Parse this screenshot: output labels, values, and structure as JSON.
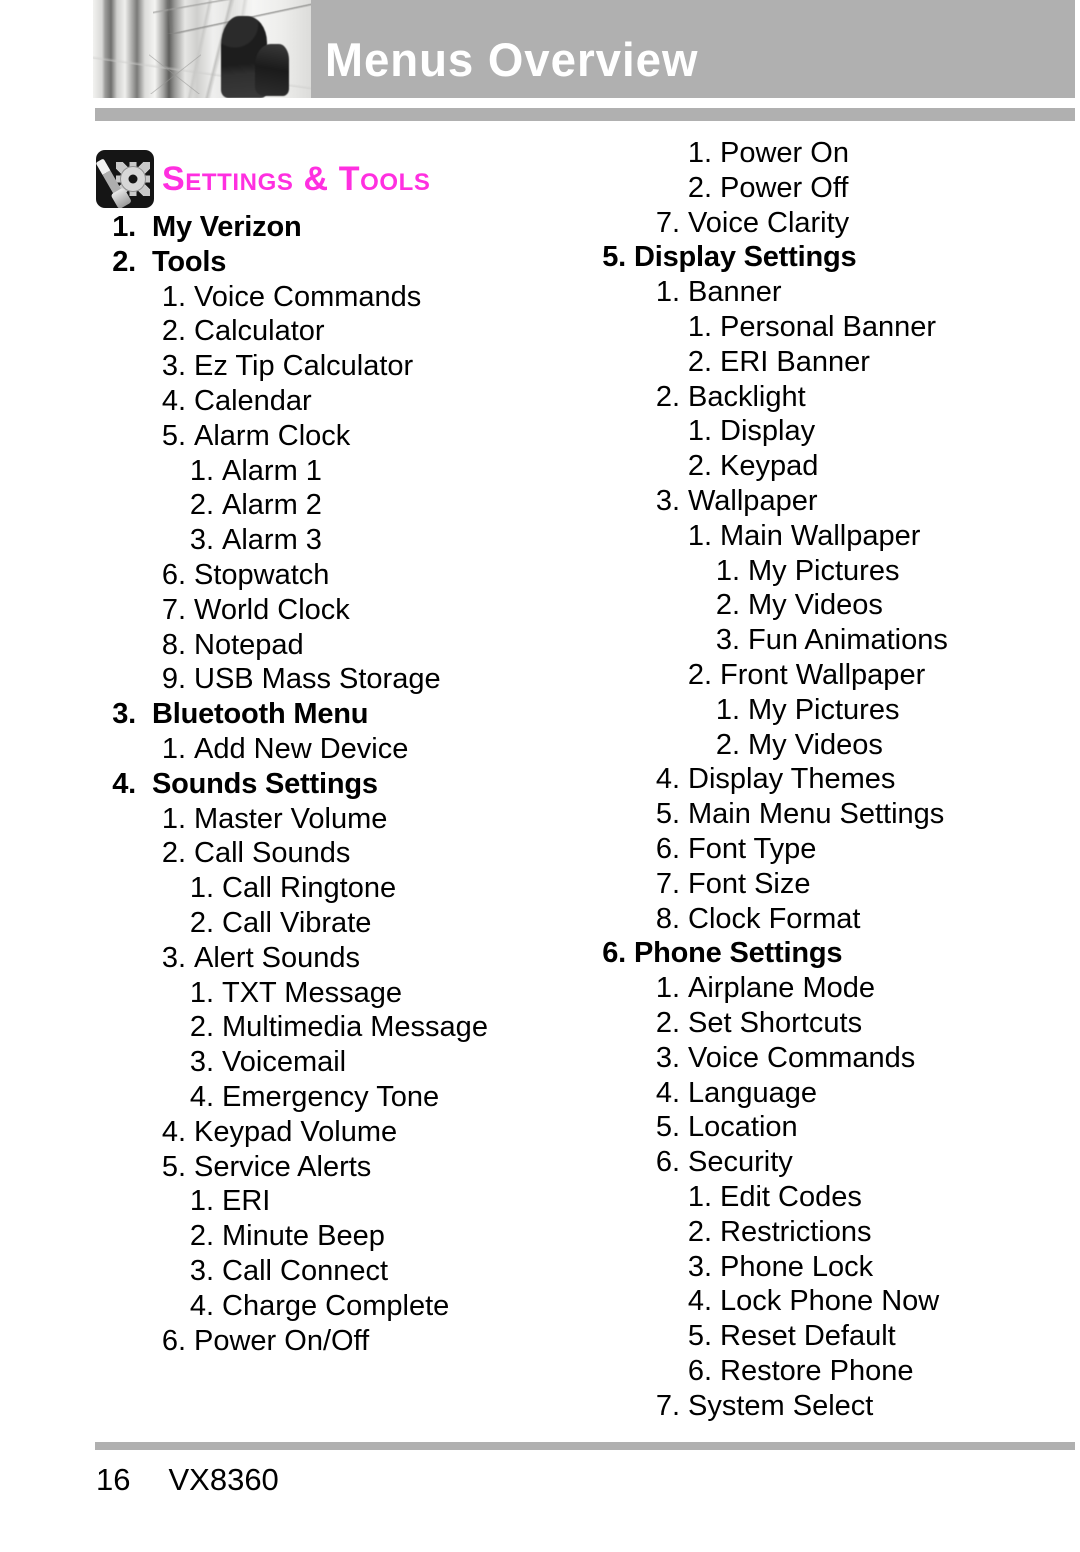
{
  "header": {
    "title": "Menus Overview",
    "photo_alt": "grayscale-architecture-photo"
  },
  "section": {
    "icon_name": "settings-tools-icon",
    "title": "Settings & Tools"
  },
  "left_column": [
    {
      "level": 1,
      "num": "1.",
      "label": "My Verizon",
      "bold": true
    },
    {
      "level": 1,
      "num": "2.",
      "label": "Tools",
      "bold": true
    },
    {
      "level": 2,
      "num": "1.",
      "label": "Voice Commands",
      "bold": false
    },
    {
      "level": 2,
      "num": "2.",
      "label": "Calculator",
      "bold": false
    },
    {
      "level": 2,
      "num": "3.",
      "label": "Ez Tip Calculator",
      "bold": false
    },
    {
      "level": 2,
      "num": "4.",
      "label": "Calendar",
      "bold": false
    },
    {
      "level": 2,
      "num": "5.",
      "label": "Alarm Clock",
      "bold": false
    },
    {
      "level": 3,
      "num": "1.",
      "label": "Alarm 1",
      "bold": false
    },
    {
      "level": 3,
      "num": "2.",
      "label": "Alarm 2",
      "bold": false
    },
    {
      "level": 3,
      "num": "3.",
      "label": "Alarm 3",
      "bold": false
    },
    {
      "level": 2,
      "num": "6.",
      "label": "Stopwatch",
      "bold": false
    },
    {
      "level": 2,
      "num": "7.",
      "label": "World Clock",
      "bold": false
    },
    {
      "level": 2,
      "num": "8.",
      "label": "Notepad",
      "bold": false
    },
    {
      "level": 2,
      "num": "9.",
      "label": "USB Mass Storage",
      "bold": false
    },
    {
      "level": 1,
      "num": "3.",
      "label": "Bluetooth Menu",
      "bold": true
    },
    {
      "level": 2,
      "num": "1.",
      "label": "Add New Device",
      "bold": false
    },
    {
      "level": 1,
      "num": "4.",
      "label": "Sounds Settings",
      "bold": true
    },
    {
      "level": 2,
      "num": "1.",
      "label": "Master Volume",
      "bold": false
    },
    {
      "level": 2,
      "num": "2.",
      "label": "Call Sounds",
      "bold": false
    },
    {
      "level": 3,
      "num": "1.",
      "label": "Call Ringtone",
      "bold": false
    },
    {
      "level": 3,
      "num": "2.",
      "label": "Call Vibrate",
      "bold": false
    },
    {
      "level": 2,
      "num": "3.",
      "label": "Alert Sounds",
      "bold": false
    },
    {
      "level": 3,
      "num": "1.",
      "label": "TXT Message",
      "bold": false
    },
    {
      "level": 3,
      "num": "2.",
      "label": "Multimedia Message",
      "bold": false
    },
    {
      "level": 3,
      "num": "3.",
      "label": "Voicemail",
      "bold": false
    },
    {
      "level": 3,
      "num": "4.",
      "label": "Emergency Tone",
      "bold": false
    },
    {
      "level": 2,
      "num": "4.",
      "label": "Keypad Volume",
      "bold": false
    },
    {
      "level": 2,
      "num": "5.",
      "label": "Service Alerts",
      "bold": false
    },
    {
      "level": 3,
      "num": "1.",
      "label": "ERI",
      "bold": false
    },
    {
      "level": 3,
      "num": "2.",
      "label": "Minute Beep",
      "bold": false
    },
    {
      "level": 3,
      "num": "3.",
      "label": "Call Connect",
      "bold": false
    },
    {
      "level": 3,
      "num": "4.",
      "label": "Charge Complete",
      "bold": false
    },
    {
      "level": 2,
      "num": "6.",
      "label": "Power On/Off",
      "bold": false
    }
  ],
  "right_column": [
    {
      "level": 3,
      "num": "1.",
      "label": "Power On",
      "bold": false
    },
    {
      "level": 3,
      "num": "2.",
      "label": "Power Off",
      "bold": false
    },
    {
      "level": 2,
      "num": "7.",
      "label": "Voice Clarity",
      "bold": false
    },
    {
      "level": 1,
      "num": "5.",
      "label": "Display Settings",
      "bold": true
    },
    {
      "level": 2,
      "num": "1.",
      "label": "Banner",
      "bold": false
    },
    {
      "level": 3,
      "num": "1.",
      "label": "Personal Banner",
      "bold": false
    },
    {
      "level": 3,
      "num": "2.",
      "label": "ERI Banner",
      "bold": false
    },
    {
      "level": 2,
      "num": "2.",
      "label": "Backlight",
      "bold": false
    },
    {
      "level": 3,
      "num": "1.",
      "label": "Display",
      "bold": false
    },
    {
      "level": 3,
      "num": "2.",
      "label": "Keypad",
      "bold": false
    },
    {
      "level": 2,
      "num": "3.",
      "label": "Wallpaper",
      "bold": false
    },
    {
      "level": 3,
      "num": "1.",
      "label": "Main Wallpaper",
      "bold": false
    },
    {
      "level": 4,
      "num": "1.",
      "label": "My Pictures",
      "bold": false
    },
    {
      "level": 4,
      "num": "2.",
      "label": "My Videos",
      "bold": false
    },
    {
      "level": 4,
      "num": "3.",
      "label": "Fun Animations",
      "bold": false
    },
    {
      "level": 3,
      "num": "2.",
      "label": "Front Wallpaper",
      "bold": false
    },
    {
      "level": 4,
      "num": "1.",
      "label": "My Pictures",
      "bold": false
    },
    {
      "level": 4,
      "num": "2.",
      "label": "My Videos",
      "bold": false
    },
    {
      "level": 2,
      "num": "4.",
      "label": "Display Themes",
      "bold": false
    },
    {
      "level": 2,
      "num": "5.",
      "label": "Main Menu Settings",
      "bold": false
    },
    {
      "level": 2,
      "num": "6.",
      "label": "Font Type",
      "bold": false
    },
    {
      "level": 2,
      "num": "7.",
      "label": "Font Size",
      "bold": false
    },
    {
      "level": 2,
      "num": "8.",
      "label": "Clock Format",
      "bold": false
    },
    {
      "level": 1,
      "num": "6.",
      "label": "Phone Settings",
      "bold": true
    },
    {
      "level": 2,
      "num": "1.",
      "label": "Airplane Mode",
      "bold": false
    },
    {
      "level": 2,
      "num": "2.",
      "label": "Set Shortcuts",
      "bold": false
    },
    {
      "level": 2,
      "num": "3.",
      "label": "Voice Commands",
      "bold": false
    },
    {
      "level": 2,
      "num": "4.",
      "label": "Language",
      "bold": false
    },
    {
      "level": 2,
      "num": "5.",
      "label": "Location",
      "bold": false
    },
    {
      "level": 2,
      "num": "6.",
      "label": "Security",
      "bold": false
    },
    {
      "level": 3,
      "num": "1.",
      "label": "Edit Codes",
      "bold": false
    },
    {
      "level": 3,
      "num": "2.",
      "label": "Restrictions",
      "bold": false
    },
    {
      "level": 3,
      "num": "3.",
      "label": "Phone Lock",
      "bold": false
    },
    {
      "level": 3,
      "num": "4.",
      "label": "Lock Phone Now",
      "bold": false
    },
    {
      "level": 3,
      "num": "5.",
      "label": "Reset Default",
      "bold": false
    },
    {
      "level": 3,
      "num": "6.",
      "label": "Restore Phone",
      "bold": false
    },
    {
      "level": 2,
      "num": "7.",
      "label": "System Select",
      "bold": false
    }
  ],
  "footer": {
    "page_number": "16",
    "model": "VX8360"
  },
  "colors": {
    "accent_magenta": "#ff2fe0",
    "header_band_gray": "#b0b0b0",
    "text_black": "#000000",
    "header_title_white": "#ffffff"
  }
}
